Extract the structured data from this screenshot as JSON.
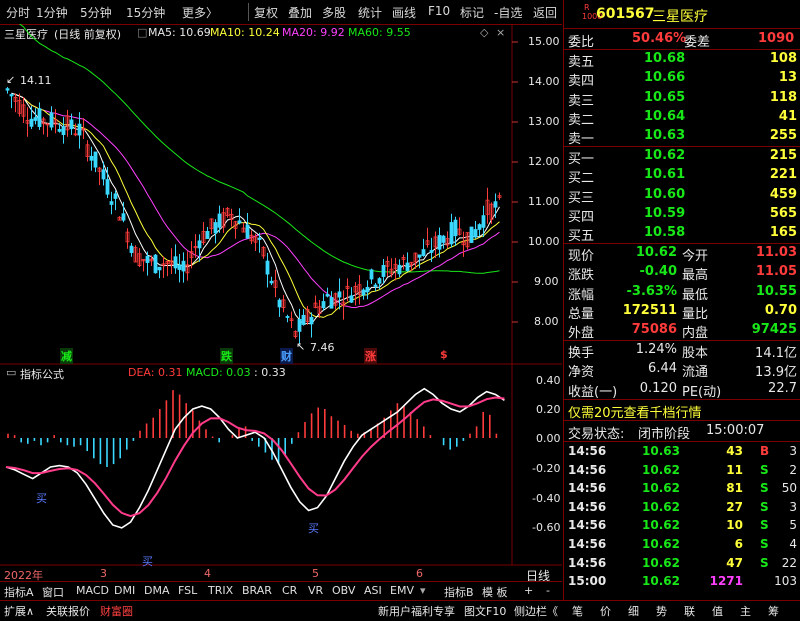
{
  "toolbar": {
    "items": [
      "分时",
      "1分钟",
      "5分钟",
      "15分钟",
      "更多〉",
      "复权",
      "叠加",
      "多股",
      "统计",
      "画线",
      "F10",
      "标记",
      "-自选",
      "返回"
    ]
  },
  "chart": {
    "title": "三星医疗",
    "mode": "(日线 前复权)",
    "ma5": "MA5: 10.69",
    "ma10": "MA10: 10.24",
    "ma20": "MA20: 9.92",
    "ma60": "MA60: 9.55",
    "high_label": "14.11",
    "low_label": "7.46",
    "yticks": [
      "15.00",
      "14.00",
      "13.00",
      "12.00",
      "11.00",
      "10.00",
      "9.00",
      "8.00"
    ],
    "events": [
      {
        "text": "减",
        "color": "#18e818"
      },
      {
        "text": "跌",
        "color": "#18e818"
      },
      {
        "text": "财",
        "color": "#4aa0ff"
      },
      {
        "text": "涨",
        "color": "#ff3b3b"
      },
      {
        "text": "$",
        "color": "#ff3b3b"
      }
    ]
  },
  "indicator": {
    "title": "指标公式",
    "dea": "DEA: 0.31",
    "macd": "MACD: 0.03",
    "extra": ": 0.33",
    "yticks": [
      "0.40",
      "0.20",
      "0.00",
      "-0.20",
      "-0.40",
      "-0.60"
    ],
    "buy_label": "买",
    "macd_bars": [
      0.03,
      0.02,
      -0.03,
      -0.04,
      -0.02,
      -0.05,
      -0.03,
      0.02,
      -0.03,
      -0.05,
      -0.06,
      -0.05,
      -0.09,
      -0.14,
      -0.18,
      -0.2,
      -0.18,
      -0.14,
      -0.08,
      -0.02,
      0.05,
      0.1,
      0.14,
      0.2,
      0.26,
      0.33,
      0.3,
      0.24,
      0.19,
      0.12,
      0.06,
      0.01,
      -0.03,
      0.0,
      0.02,
      0.07,
      0.08,
      -0.02,
      -0.06,
      -0.1,
      -0.15,
      -0.18,
      -0.12,
      -0.04,
      0.04,
      0.11,
      0.17,
      0.21,
      0.2,
      0.15,
      0.12,
      0.09,
      0.05,
      0.03,
      0.04,
      0.06,
      0.1,
      0.14,
      0.19,
      0.24,
      0.22,
      0.18,
      0.13,
      0.08,
      0.02,
      0.0,
      -0.05,
      -0.08,
      -0.06,
      -0.02,
      0.03,
      0.08,
      0.18,
      0.16,
      0.03
    ]
  },
  "xaxis": {
    "labels": [
      "2022年",
      "3",
      "4",
      "5",
      "6"
    ],
    "right": "日线"
  },
  "tabs": [
    "指标A",
    "窗口",
    "MACD",
    "DMI",
    "DMA",
    "FSL",
    "TRIX",
    "BRAR",
    "CR",
    "VR",
    "OBV",
    "ASI",
    "EMV",
    "指标B",
    "模 板",
    "+",
    "-"
  ],
  "status": {
    "left": [
      "扩展∧",
      "关联报价",
      "财富圈"
    ],
    "right": [
      "新用户福利专享",
      "图文F10",
      "侧边栏《"
    ],
    "keys": [
      "笔",
      "价",
      "细",
      "势",
      "联",
      "值",
      "主",
      "筹"
    ]
  },
  "quote": {
    "code": "601567",
    "name": "三星医疗",
    "badge": "R",
    "weibi_label": "委比",
    "weibi": "50.46%",
    "weicha_label": "委差",
    "weicha": "1090",
    "asks": [
      {
        "label": "卖五",
        "price": "10.68",
        "vol": "108"
      },
      {
        "label": "卖四",
        "price": "10.66",
        "vol": "13"
      },
      {
        "label": "卖三",
        "price": "10.65",
        "vol": "118"
      },
      {
        "label": "卖二",
        "price": "10.64",
        "vol": "41"
      },
      {
        "label": "卖一",
        "price": "10.63",
        "vol": "255"
      }
    ],
    "bids": [
      {
        "label": "买一",
        "price": "10.62",
        "vol": "215"
      },
      {
        "label": "买二",
        "price": "10.61",
        "vol": "221"
      },
      {
        "label": "买三",
        "price": "10.60",
        "vol": "459"
      },
      {
        "label": "买四",
        "price": "10.59",
        "vol": "565"
      },
      {
        "label": "买五",
        "price": "10.58",
        "vol": "165"
      }
    ],
    "stats": [
      {
        "l1": "现价",
        "v1": "10.62",
        "c1": "green",
        "l2": "今开",
        "v2": "11.03",
        "c2": "red"
      },
      {
        "l1": "涨跌",
        "v1": "-0.40",
        "c1": "green",
        "l2": "最高",
        "v2": "11.05",
        "c2": "red"
      },
      {
        "l1": "涨幅",
        "v1": "-3.63%",
        "c1": "green",
        "l2": "最低",
        "v2": "10.55",
        "c2": "green"
      },
      {
        "l1": "总量",
        "v1": "172511",
        "c1": "yellow",
        "l2": "量比",
        "v2": "0.70",
        "c2": "yellow"
      },
      {
        "l1": "外盘",
        "v1": "75086",
        "c1": "red",
        "l2": "内盘",
        "v2": "97425",
        "c2": "green"
      }
    ],
    "fund": [
      {
        "l1": "换手",
        "v1": "1.24%",
        "l2": "股本",
        "v2": "14.1亿"
      },
      {
        "l1": "净资",
        "v1": "6.44",
        "l2": "流通",
        "v2": "13.9亿"
      },
      {
        "l1": "收益(一)",
        "v1": "0.120",
        "l2": "PE(动)",
        "v2": "22.7"
      }
    ],
    "promo": "仅需20元查看千档行情",
    "trade_state_label": "交易状态:",
    "trade_state": "闭市阶段",
    "trade_time": "15:00:07",
    "ticks": [
      {
        "t": "14:56",
        "p": "10.63",
        "v": "43",
        "s": "B",
        "n": "3"
      },
      {
        "t": "14:56",
        "p": "10.62",
        "v": "11",
        "s": "S",
        "n": "2"
      },
      {
        "t": "14:56",
        "p": "10.62",
        "v": "81",
        "s": "S",
        "n": "50"
      },
      {
        "t": "14:56",
        "p": "10.62",
        "v": "27",
        "s": "S",
        "n": "3"
      },
      {
        "t": "14:56",
        "p": "10.62",
        "v": "10",
        "s": "S",
        "n": "5"
      },
      {
        "t": "14:56",
        "p": "10.62",
        "v": "6",
        "s": "S",
        "n": "4"
      },
      {
        "t": "14:56",
        "p": "10.62",
        "v": "47",
        "s": "S",
        "n": "22"
      },
      {
        "t": "15:00",
        "p": "10.62",
        "v": "1271",
        "s": "",
        "n": "103"
      }
    ]
  },
  "colors": {
    "up": "#ff3b3b",
    "down": "#18e818",
    "frame": "#7a0000",
    "ma5": "#ffffff",
    "ma10": "#ffff3a",
    "ma20": "#ff40ff",
    "ma60": "#18e818",
    "dif": "#ffffff",
    "dea": "#ff3b8a",
    "cyan": "#3ad8ff"
  }
}
